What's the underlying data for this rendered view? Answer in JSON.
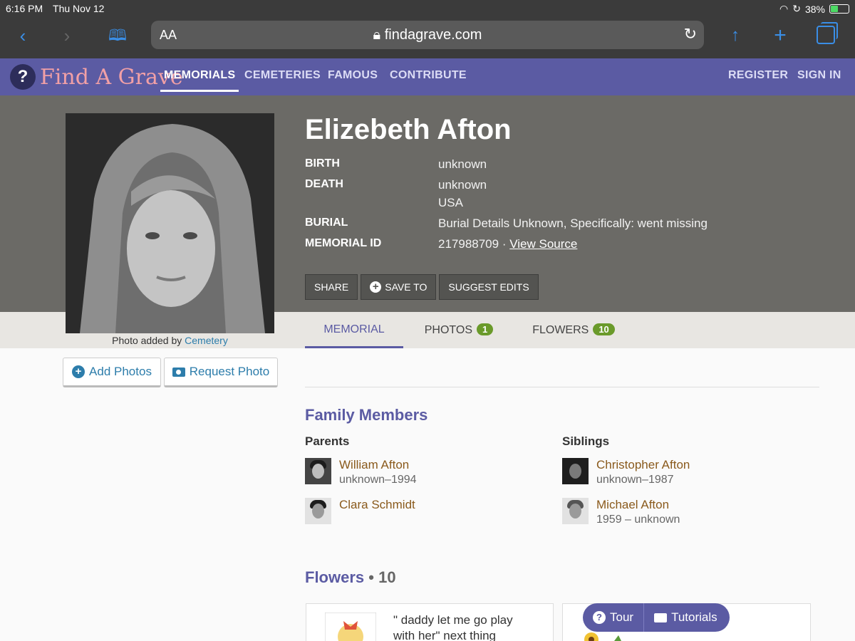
{
  "status": {
    "time": "6:16 PM",
    "date": "Thu Nov 12",
    "battery": "38%"
  },
  "browser": {
    "aa": "AA",
    "url": "findagrave.com"
  },
  "site": {
    "logo": "Find A Grave",
    "nav": [
      "MEMORIALS",
      "CEMETERIES",
      "FAMOUS",
      "CONTRIBUTE"
    ],
    "register": "REGISTER",
    "signin": "SIGN IN"
  },
  "memorial": {
    "name": "Elizebeth Afton",
    "photo_caption_prefix": "Photo added by",
    "photo_caption_link": "Cemetery",
    "facts": [
      {
        "label": "BIRTH",
        "value": "unknown"
      },
      {
        "label": "DEATH",
        "value": "unknown",
        "value2": "USA"
      },
      {
        "label": "BURIAL",
        "value": "Burial Details Unknown, Specifically: went missing"
      },
      {
        "label": "MEMORIAL ID",
        "value": "217988709 ·",
        "link": "View Source"
      }
    ],
    "actions": {
      "share": "SHARE",
      "save": "SAVE TO",
      "suggest": "SUGGEST EDITS"
    },
    "tabs": [
      {
        "label": "MEMORIAL"
      },
      {
        "label": "PHOTOS",
        "badge": "1"
      },
      {
        "label": "FLOWERS",
        "badge": "10"
      }
    ],
    "add_photos": "Add Photos",
    "request_photo": "Request Photo"
  },
  "family": {
    "heading": "Family Members",
    "parents_label": "Parents",
    "siblings_label": "Siblings",
    "parents": [
      {
        "name": "William Afton",
        "dates": "unknown–1994"
      },
      {
        "name": "Clara Schmidt",
        "dates": ""
      }
    ],
    "siblings": [
      {
        "name": "Christopher Afton",
        "dates": "unknown–1987"
      },
      {
        "name": "Michael Afton",
        "dates": "1959 – unknown"
      }
    ]
  },
  "flowers": {
    "heading": "Flowers",
    "count": "• 10",
    "card_text": "\" daddy let me go play with her\" next thing"
  },
  "help": {
    "tour": "Tour",
    "tutorials": "Tutorials"
  }
}
